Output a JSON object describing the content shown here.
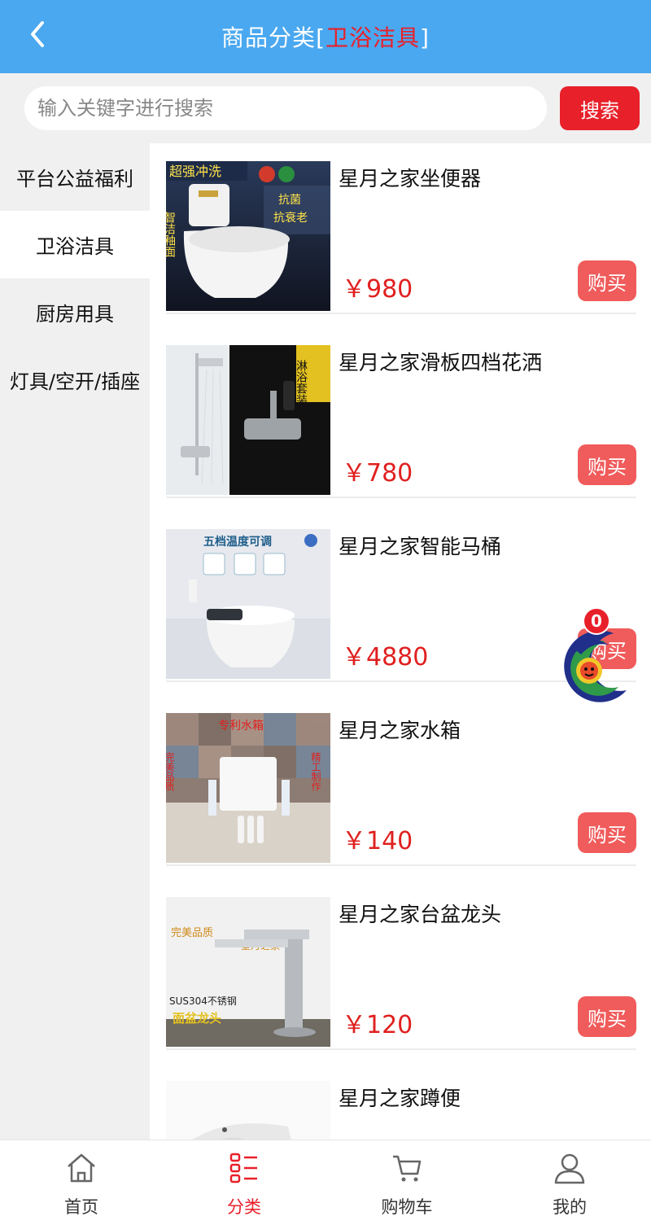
{
  "header": {
    "title_prefix": "商品分类",
    "bracket_open": "[",
    "current_category": "卫浴洁具",
    "bracket_close": "]"
  },
  "search": {
    "placeholder": "输入关键字进行搜索",
    "value": "",
    "button_label": "搜索"
  },
  "sidebar": {
    "items": [
      {
        "label": "平台公益福利",
        "active": false
      },
      {
        "label": "卫浴洁具",
        "active": true
      },
      {
        "label": "厨房用具",
        "active": false
      },
      {
        "label": "灯具/空开/插座",
        "active": false
      }
    ]
  },
  "products": [
    {
      "name": "星月之家坐便器",
      "price": "￥980",
      "buy": "购买",
      "img_texts": {
        "banner": "超强冲洗",
        "side": "智洁釉面",
        "badge1": "抗菌",
        "badge2": "抗衰老"
      }
    },
    {
      "name": "星月之家滑板四档花洒",
      "price": "￥780",
      "buy": "购买",
      "img_texts": {
        "tag": "淋浴套装"
      }
    },
    {
      "name": "星月之家智能马桶",
      "price": "￥4880",
      "buy": "购买",
      "img_texts": {
        "banner": "五档温度可调"
      }
    },
    {
      "name": "星月之家水箱",
      "price": "￥140",
      "buy": "购买",
      "img_texts": {
        "banner": "专利水箱",
        "left": "完美品质",
        "right": "精工制作"
      }
    },
    {
      "name": "星月之家台盆龙头",
      "price": "￥120",
      "buy": "购买",
      "img_texts": {
        "line1": "完美品质",
        "line2": "星月之家",
        "line3": "SUS304不锈钢",
        "line4": "面盆龙头"
      }
    },
    {
      "name": "星月之家蹲便",
      "price": "",
      "buy": ""
    }
  ],
  "cart_float": {
    "count": "0"
  },
  "tabbar": {
    "items": [
      {
        "label": "首页",
        "icon": "home-icon"
      },
      {
        "label": "分类",
        "icon": "category-icon",
        "active": true
      },
      {
        "label": "购物车",
        "icon": "cart-icon"
      },
      {
        "label": "我的",
        "icon": "user-icon"
      }
    ]
  },
  "colors": {
    "header": "#4aa8f0",
    "accent": "#e8202a",
    "buy": "#f05b5b",
    "price": "#e0201f"
  }
}
